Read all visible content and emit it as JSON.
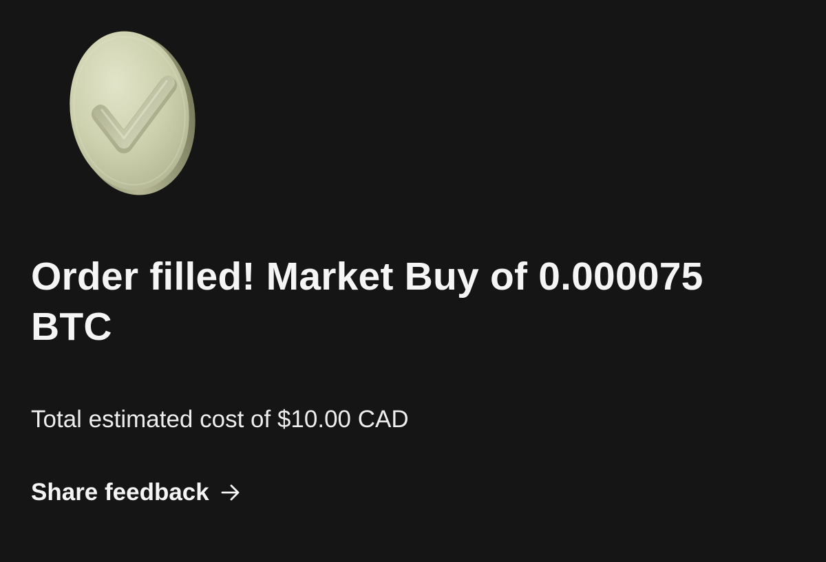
{
  "confirmation": {
    "icon": "check-coin-icon",
    "headline": "Order filled! Market Buy of 0.000075 BTC",
    "subtitle": "Total estimated cost of $10.00 CAD",
    "feedback_label": "Share feedback",
    "feedback_icon": "arrow-right-icon"
  },
  "colors": {
    "background": "#151515",
    "text": "#f5f5f5",
    "coin": "#c9ccaa"
  }
}
